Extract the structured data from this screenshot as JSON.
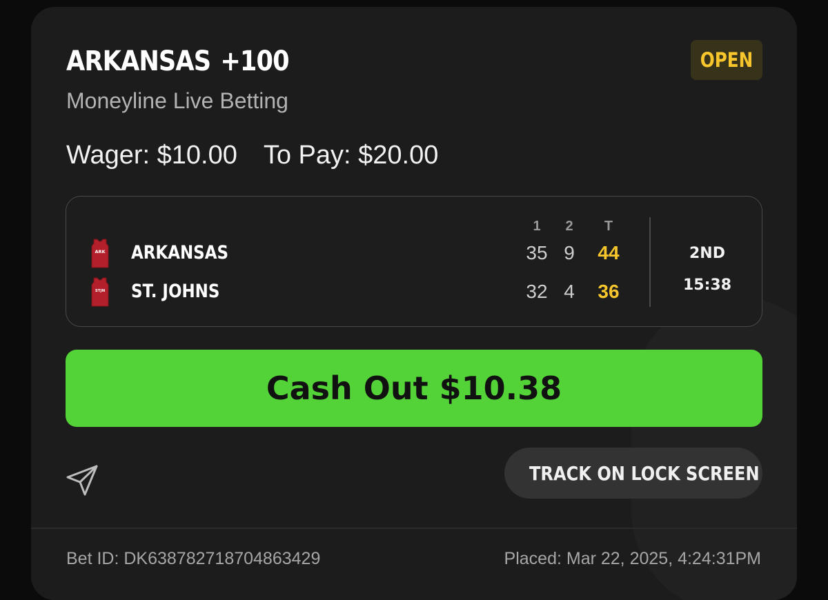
{
  "bet": {
    "team": "ARKANSAS",
    "odds": "+100",
    "status": "OPEN",
    "market": "Moneyline Live Betting",
    "wager_label": "Wager: $10.00",
    "to_pay_label": "To Pay: $20.00"
  },
  "scoreboard": {
    "columns": [
      "1",
      "2",
      "T"
    ],
    "teams": [
      {
        "name": "ARKANSAS",
        "jersey_abbr": "ARK",
        "scores": [
          "35",
          "9",
          "44"
        ]
      },
      {
        "name": "ST. JOHNS",
        "jersey_abbr": "STJN",
        "scores": [
          "32",
          "4",
          "36"
        ]
      }
    ],
    "period": "2ND",
    "clock": "15:38"
  },
  "actions": {
    "cashout_label": "Cash Out $10.38",
    "share_icon": "send-icon",
    "track_icon": "clock-icon",
    "track_label": "TRACK ON LOCK SCREEN"
  },
  "footer": {
    "bet_id": "Bet ID: DK638782718704863429",
    "placed": "Placed: Mar 22, 2025, 4:24:31PM"
  },
  "colors": {
    "accent_green": "#53d337",
    "status_yellow": "#f7c52c",
    "card_bg": "#1c1c1c",
    "jersey_red": "#b3202b"
  }
}
